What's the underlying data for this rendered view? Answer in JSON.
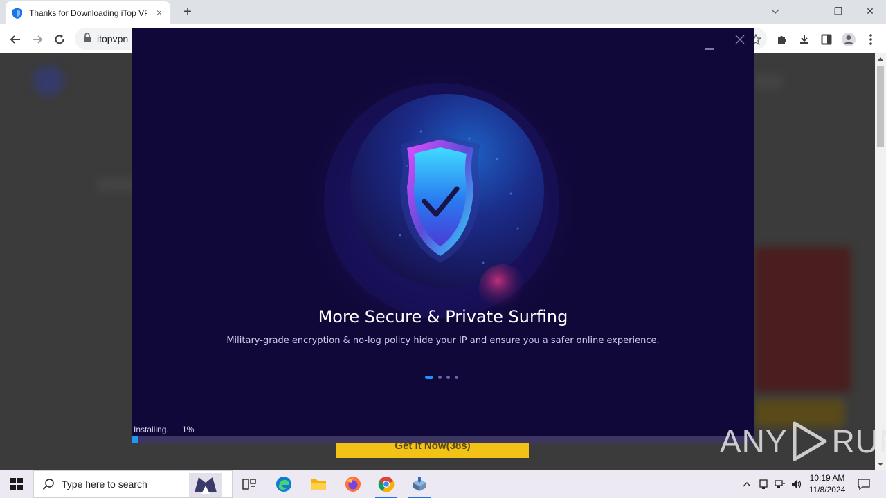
{
  "browser": {
    "tab_title": "Thanks for Downloading iTop VPN",
    "tab_close": "×",
    "new_tab": "+",
    "url": "itopvpn",
    "window_controls": {
      "minimize": "—",
      "restore": "❐",
      "close": "✕"
    }
  },
  "website": {
    "cta_label": "Get It Now(38s)"
  },
  "installer": {
    "headline": "More Secure & Private Surfing",
    "subline": "Military-grade encryption & no-log policy hide your IP and ensure you a safer online experience.",
    "carousel": {
      "count": 4,
      "active_index": 0
    },
    "status_label": "Installing.",
    "progress_text": "1%",
    "progress_value": 1,
    "colors": {
      "background": "#11083a",
      "accent": "#2196f3",
      "shield_cyan": "#27d3ff",
      "shield_magenta": "#d24bff"
    }
  },
  "watermark": {
    "text_left": "ANY",
    "text_right": "RUN"
  },
  "taskbar": {
    "search_placeholder": "Type here to search",
    "apps": [
      "task-view-icon",
      "edge-icon",
      "file-explorer-icon",
      "firefox-icon",
      "chrome-icon",
      "installer-app-icon"
    ],
    "clock_time": "10:19 AM",
    "clock_date": "11/8/2024"
  }
}
